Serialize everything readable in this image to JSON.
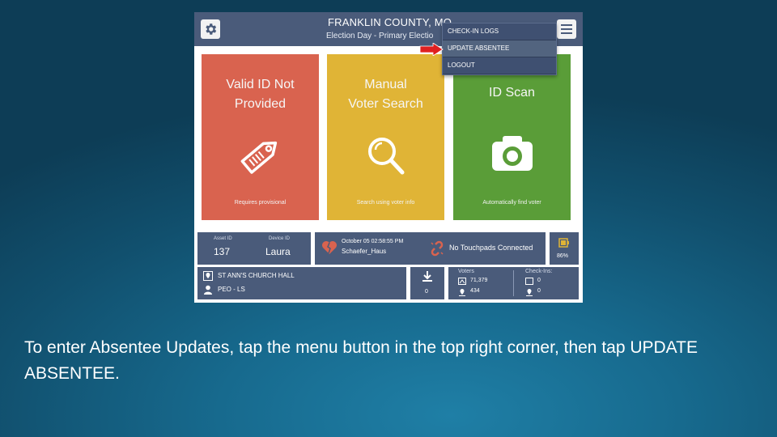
{
  "header": {
    "county": "FRANKLIN COUNTY, MO",
    "subtitle": "Election Day - Primary Electio"
  },
  "menu": {
    "items": [
      "CHECK-IN LOGS",
      "UPDATE ABSENTEE",
      "LOGOUT"
    ]
  },
  "tiles": [
    {
      "title_line1": "Valid ID Not",
      "title_line2": "Provided",
      "desc": "Requires provisional"
    },
    {
      "title_line1": "Manual",
      "title_line2": "Voter Search",
      "desc": "Search using voter info"
    },
    {
      "title_line1": "ID Scan",
      "title_line2": "",
      "desc": "Automatically find voter"
    }
  ],
  "status": {
    "asset_label": "Asset ID",
    "asset_value": "137",
    "device_label": "Device ID",
    "device_value": "Laura",
    "datetime": "October 05 02:58:55 PM",
    "user": "Schaefer_Haus",
    "touchpads": "No Touchpads Connected",
    "battery": "86%"
  },
  "location": {
    "polling_place": "ST ANN'S CHURCH HALL",
    "user_role": "PEO - LS",
    "download_count": "0"
  },
  "voters": {
    "label": "Voters",
    "total": "71,379",
    "local": "434"
  },
  "checkins": {
    "label": "Check-Ins:",
    "total": "0",
    "local": "0"
  },
  "colors": {
    "header": "#4a5b7a",
    "red_tile": "#d9634f",
    "yellow_tile": "#e0b436",
    "green_tile": "#5a9d38",
    "arrow": "#e02020"
  },
  "caption": "To enter Absentee Updates, tap the menu button in the top right corner, then tap UPDATE ABSENTEE."
}
